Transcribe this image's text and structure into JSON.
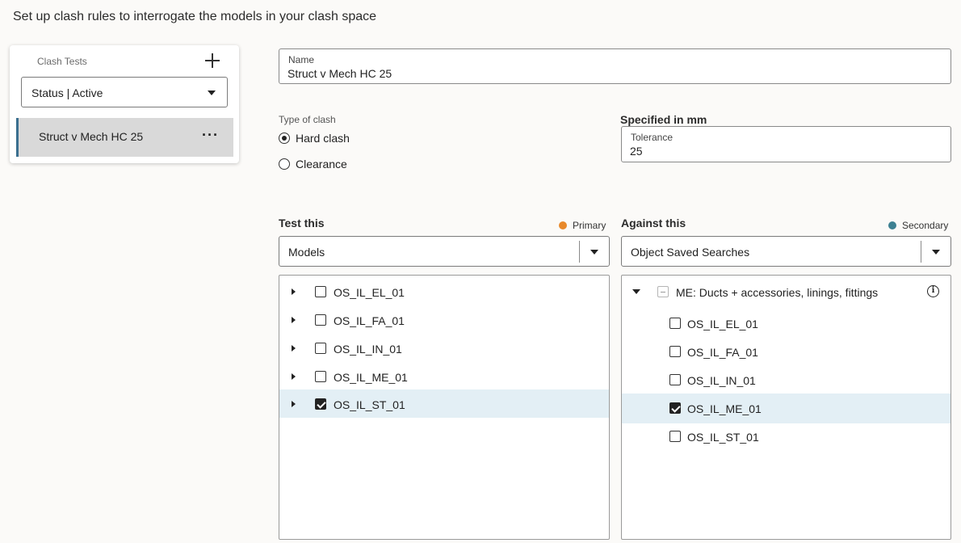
{
  "page": {
    "title": "Set up clash rules to interrogate the models in your clash space"
  },
  "clash_tests": {
    "label": "Clash Tests",
    "add_icon": "plus-icon",
    "status_filter": "Status | Active",
    "items": [
      {
        "label": "Struct v Mech HC 25",
        "selected": true,
        "more_icon": "ellipsis-icon"
      }
    ]
  },
  "name_field": {
    "label": "Name",
    "value": "Struct v Mech HC 25"
  },
  "type_of_clash": {
    "label": "Type of clash",
    "options": [
      {
        "label": "Hard clash",
        "selected": true
      },
      {
        "label": "Clearance",
        "selected": false
      }
    ]
  },
  "tolerance": {
    "heading": "Specified in mm",
    "label": "Tolerance",
    "value": "25"
  },
  "test_this": {
    "title": "Test this",
    "legend": "Primary",
    "legend_color": "#e8892b",
    "select_value": "Models",
    "rows": [
      {
        "label": "OS_IL_EL_01",
        "checked": false
      },
      {
        "label": "OS_IL_FA_01",
        "checked": false
      },
      {
        "label": "OS_IL_IN_01",
        "checked": false
      },
      {
        "label": "OS_IL_ME_01",
        "checked": false
      },
      {
        "label": "OS_IL_ST_01",
        "checked": true
      }
    ]
  },
  "against_this": {
    "title": "Against this",
    "legend": "Secondary",
    "legend_color": "#3d8092",
    "select_value": "Object Saved Searches",
    "group": {
      "label": "ME: Ducts + accessories, linings, fittings",
      "expanded": true,
      "info_icon": "info-icon"
    },
    "rows": [
      {
        "label": "OS_IL_EL_01",
        "checked": false
      },
      {
        "label": "OS_IL_FA_01",
        "checked": false
      },
      {
        "label": "OS_IL_IN_01",
        "checked": false
      },
      {
        "label": "OS_IL_ME_01",
        "checked": true
      },
      {
        "label": "OS_IL_ST_01",
        "checked": false
      }
    ]
  }
}
